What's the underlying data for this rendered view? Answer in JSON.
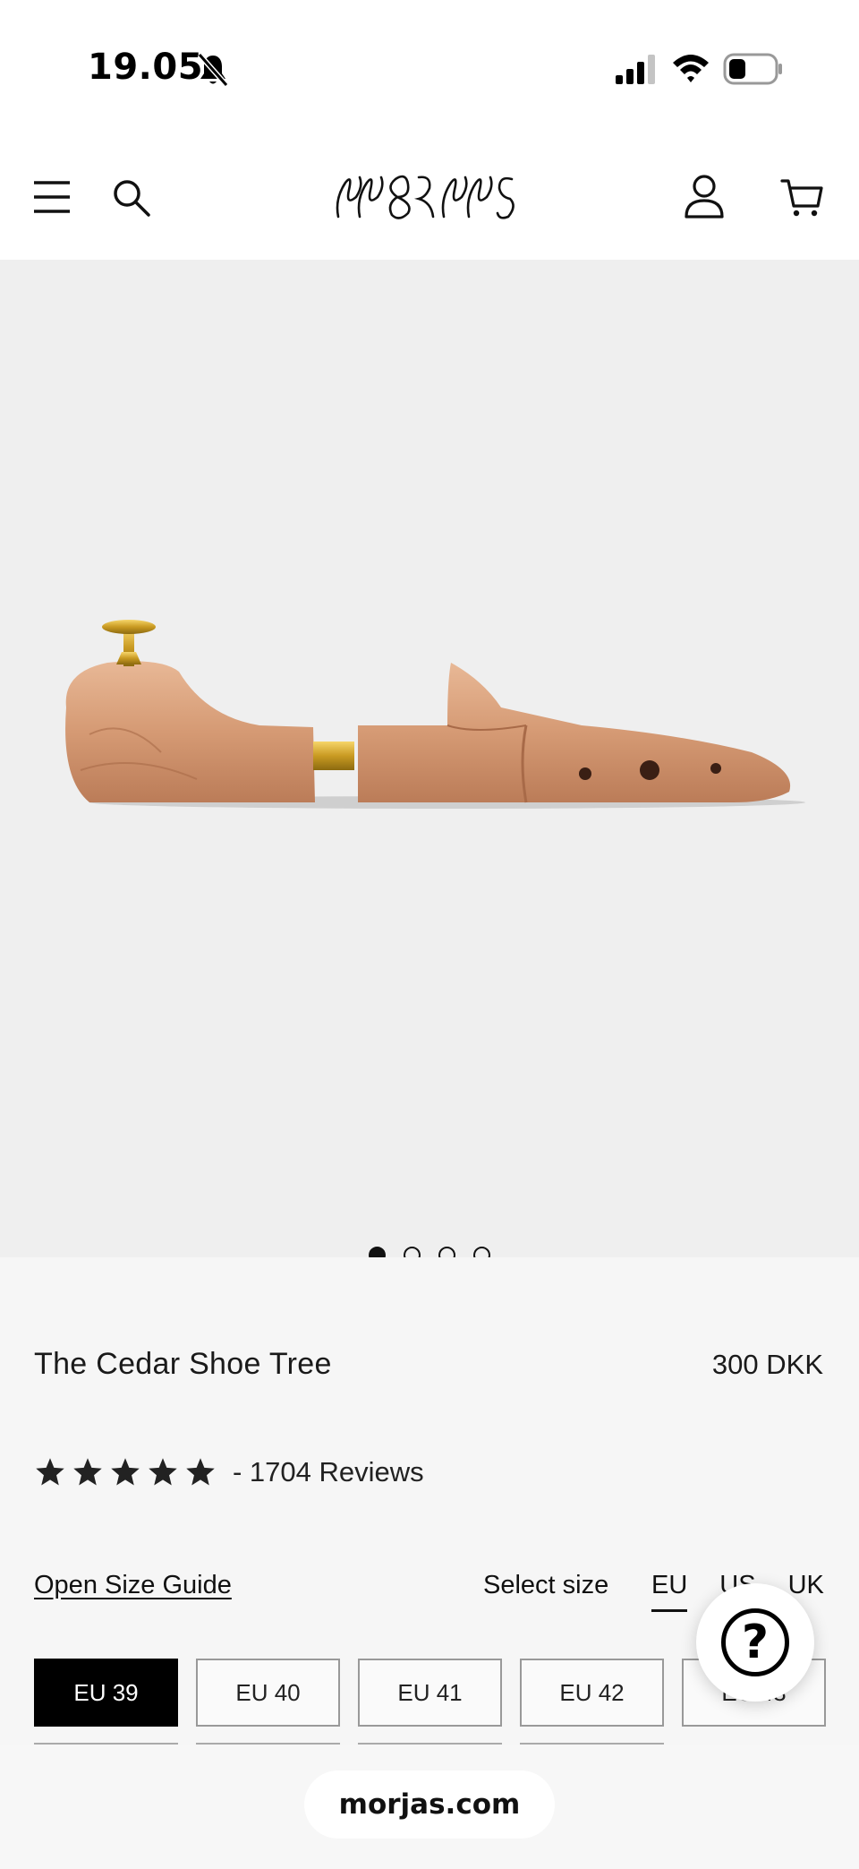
{
  "status_bar": {
    "time": "19.05",
    "icons": [
      "bell-slash-icon",
      "signal-icon",
      "wifi-icon",
      "battery-icon"
    ]
  },
  "header": {
    "brand": "MORJAS",
    "icons": [
      "menu-icon",
      "search-icon",
      "account-icon",
      "cart-icon"
    ]
  },
  "gallery": {
    "image": "cedar shoe tree",
    "slide_count": 4,
    "active_slide": 1
  },
  "product": {
    "title": "The Cedar Shoe Tree",
    "price": "300 DKK",
    "rating_stars": 5,
    "reviews": "- 1704 Reviews"
  },
  "size": {
    "guide_link": "Open Size Guide",
    "select_label": "Select size",
    "units": [
      "EU",
      "US",
      "UK"
    ],
    "active_unit": "EU",
    "options": [
      "EU 39",
      "EU 40",
      "EU 41",
      "EU 42",
      "EU 43"
    ],
    "selected": "EU 39"
  },
  "help": {
    "label": "?"
  },
  "browser": {
    "url": "morjas.com"
  },
  "colors": {
    "gallery_bg": "#efefef",
    "panel_bg": "#f6f6f6",
    "accent": "#000000",
    "wood": "#d9a17f"
  }
}
